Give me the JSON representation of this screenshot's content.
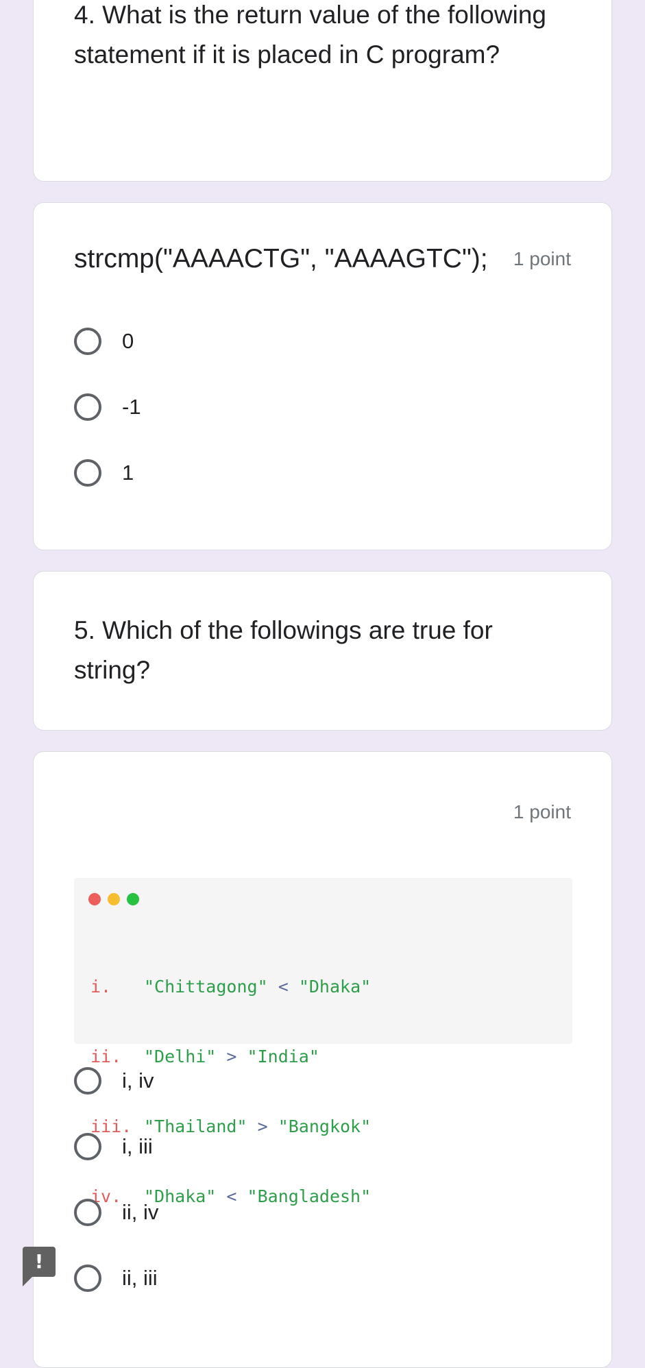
{
  "questions": [
    {
      "title": "4. What is the return value of the following statement if it is placed in C program?",
      "prompt": "strcmp(\"AAAACTG\", \"AAAAGTC\");",
      "points": "1 point",
      "options": [
        "0",
        "-1",
        "1"
      ]
    },
    {
      "title": "5. Which of the followings are true for string?",
      "points": "1 point",
      "code": {
        "window_dots": [
          "#ec5f5a",
          "#f5bd2f",
          "#29c140"
        ],
        "lines": [
          {
            "num": "i.",
            "left": "\"Chittagong\"",
            "op": "<",
            "right": "\"Dhaka\""
          },
          {
            "num": "ii.",
            "left": "\"Delhi\"",
            "op": ">",
            "right": "\"India\""
          },
          {
            "num": "iii.",
            "left": "\"Thailand\"",
            "op": ">",
            "right": "\"Bangkok\""
          },
          {
            "num": "iv.",
            "left": "\"Dhaka\"",
            "op": "<",
            "right": "\"Bangladesh\""
          }
        ],
        "colors": {
          "line_number": "#e05c5c",
          "string": "#2e9e4b",
          "operator": "#5c6a9a"
        }
      },
      "options": [
        "i, iv",
        "i, iii",
        "ii, iv",
        "ii, iii"
      ]
    }
  ],
  "feedback_button": {
    "icon": "feedback-icon",
    "glyph": "!"
  }
}
